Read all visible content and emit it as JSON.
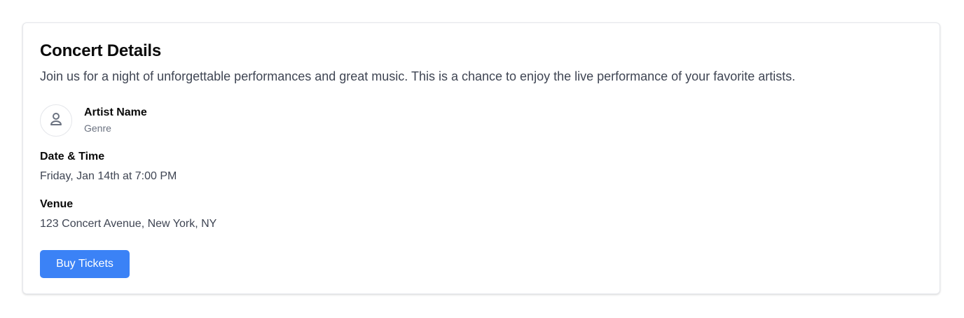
{
  "card": {
    "title": "Concert Details",
    "description": "Join us for a night of unforgettable performances and great music. This is a chance to enjoy the live performance of your favorite artists."
  },
  "artist": {
    "avatar_icon": "user-icon",
    "name": "Artist Name",
    "genre": "Genre"
  },
  "date_time": {
    "label": "Date & Time",
    "value": "Friday, Jan 14th at 7:00 PM"
  },
  "venue": {
    "label": "Venue",
    "value": "123 Concert Avenue, New York, NY"
  },
  "actions": {
    "buy_label": "Buy Tickets"
  },
  "colors": {
    "accent": "#3b82f6",
    "text_primary": "#0a0a0a",
    "text_secondary": "#3f4553",
    "text_muted": "#6b7280",
    "border": "#e5e7eb"
  }
}
